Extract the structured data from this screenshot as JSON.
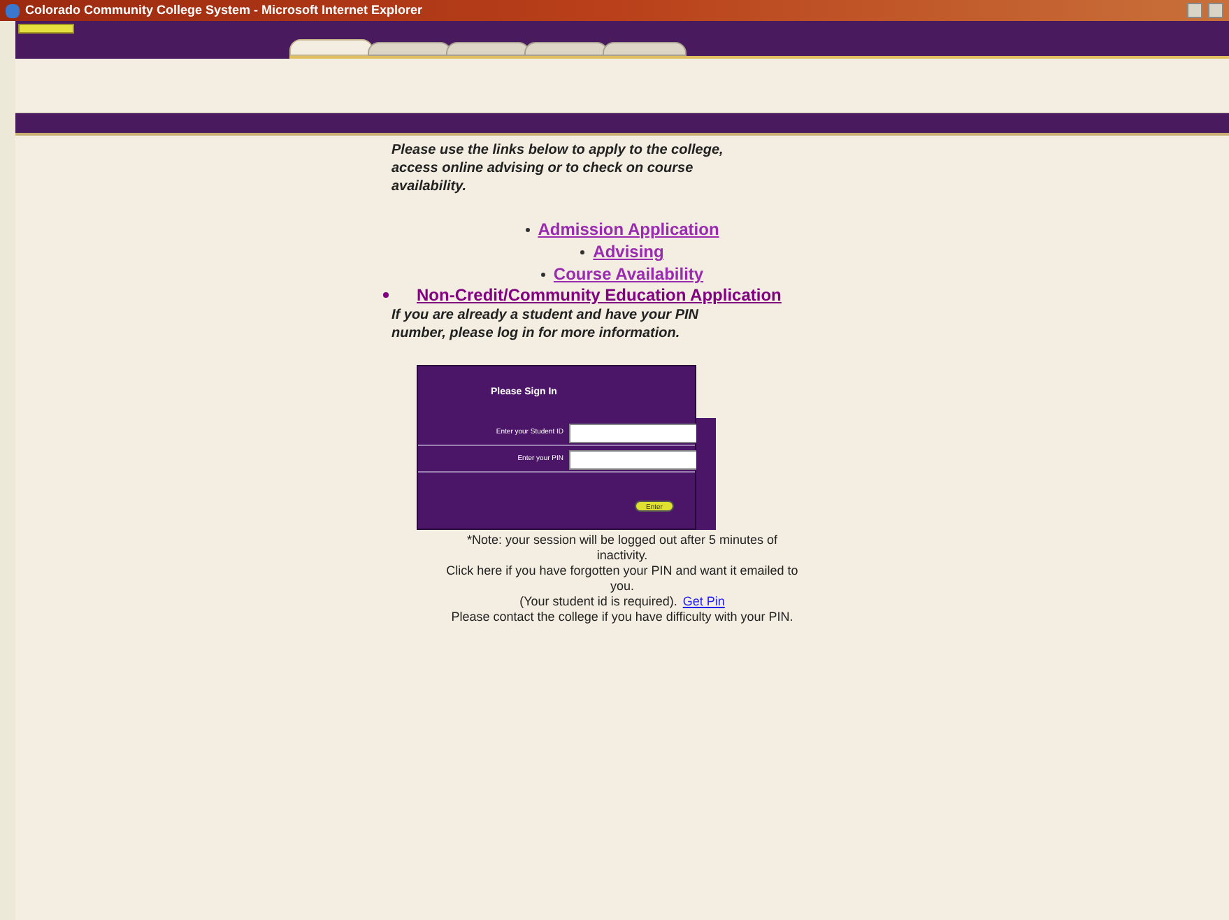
{
  "window": {
    "title": "Colorado Community College System - Microsoft Internet Explorer"
  },
  "tabs": [
    {
      "selected": true
    },
    {
      "selected": false
    },
    {
      "selected": false
    },
    {
      "selected": false
    },
    {
      "selected": false
    }
  ],
  "intro": "Please use the links below to apply to the college, access online advising or to check on course availability.",
  "links": [
    {
      "label": "Admission Application",
      "kind": "large"
    },
    {
      "label": "Advising",
      "kind": "large"
    },
    {
      "label": "Course Availability",
      "kind": "large"
    },
    {
      "label": "Non-Credit/Community Education Application",
      "kind": "plain"
    }
  ],
  "login_prompt": "If you are already a student and have your PIN number, please log in for more information.",
  "sign_in": {
    "title": "Please Sign In",
    "fields": [
      {
        "label": "Enter your Student ID"
      },
      {
        "label": "Enter your PIN"
      }
    ],
    "button": "Enter"
  },
  "note": "*Note: your session will be logged out after 5 minutes of inactivity.",
  "forgot": "Click here if you have forgotten your PIN and want it emailed to you.",
  "required": "(Your student id is required).",
  "get_pin": "Get Pin",
  "contact": "Please contact the college if you have difficulty with your PIN."
}
